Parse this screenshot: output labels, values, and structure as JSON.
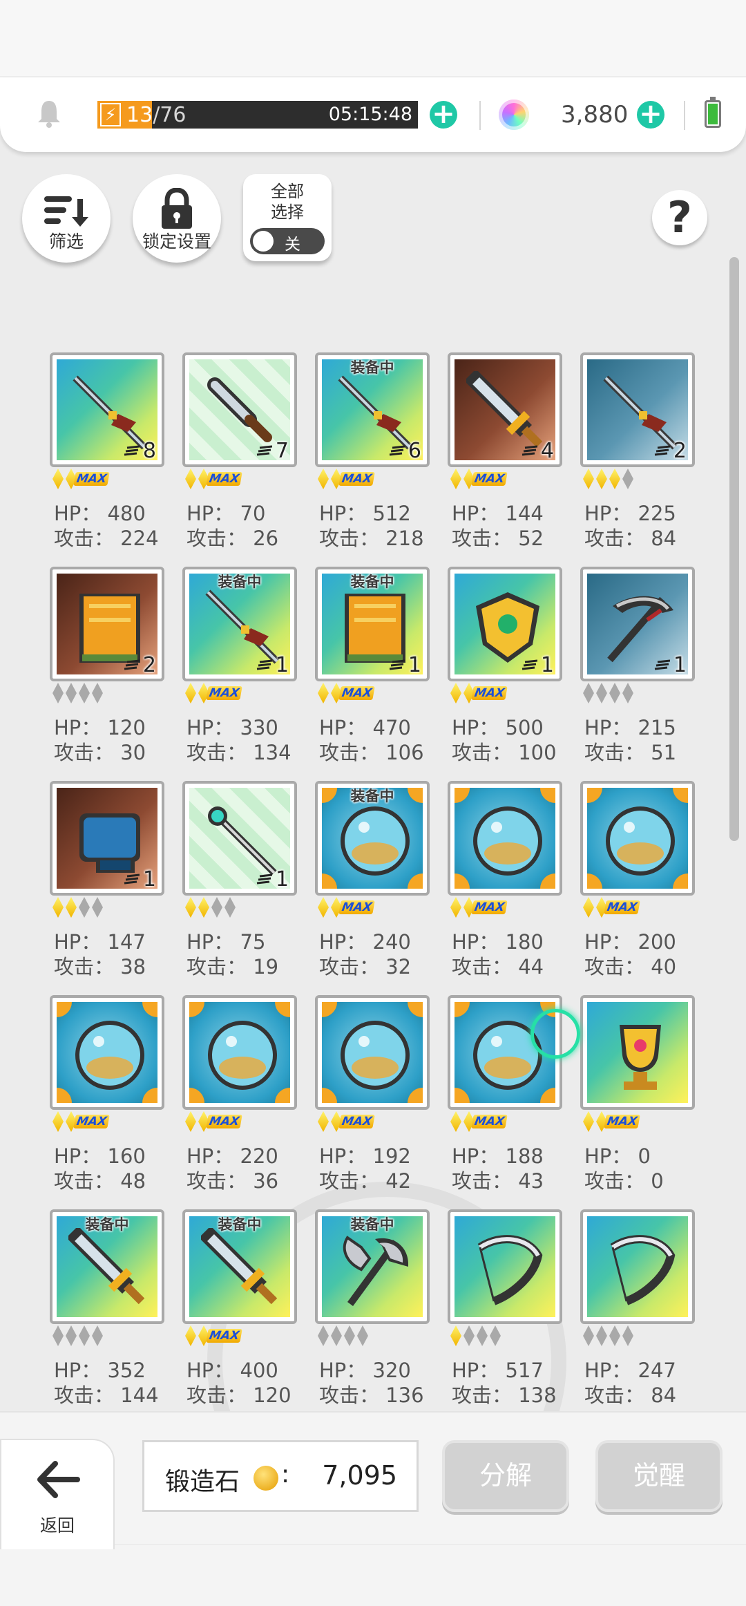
{
  "header": {
    "energy_current": "13",
    "energy_max": "/76",
    "energy_progress": 0.171,
    "timer": "05:15:48",
    "gem_count": "3,880",
    "icons": [
      "bell-icon",
      "lightning-icon",
      "plus-icon",
      "gem-icon",
      "battery-icon"
    ]
  },
  "controls": {
    "filter_label": "筛选",
    "lock_label": "锁定设置",
    "select_all_label": "全部\n选择",
    "toggle_label": "关",
    "help_label": "?"
  },
  "colors": {
    "accent_plus": "#1fc8a6",
    "energy": "#f59a1d",
    "max_badge": "#1b4fd8"
  },
  "items": [
    {
      "equipped": "",
      "count": "8",
      "stars": {
        "gold": 2,
        "grey": 0,
        "max": "MAX"
      },
      "hp": "HP： 480",
      "atk": "攻击： 224",
      "icon": "spear-icon",
      "bg": "rainbow"
    },
    {
      "equipped": "",
      "count": "7",
      "stars": {
        "gold": 2,
        "grey": 0,
        "max": "MAX"
      },
      "hp": "HP： 70",
      "atk": "攻击： 26",
      "icon": "dagger-icon",
      "bg": "mint"
    },
    {
      "equipped": "装备中",
      "count": "6",
      "stars": {
        "gold": 2,
        "grey": 0,
        "max": "MAX"
      },
      "hp": "HP： 512",
      "atk": "攻击： 218",
      "icon": "spear-icon",
      "bg": "rainbow"
    },
    {
      "equipped": "",
      "count": "4",
      "stars": {
        "gold": 2,
        "grey": 0,
        "max": "MAX"
      },
      "hp": "HP： 144",
      "atk": "攻击： 52",
      "icon": "sword-icon",
      "bg": "brown"
    },
    {
      "equipped": "",
      "count": "2",
      "stars": {
        "gold": 3,
        "grey": 1,
        "max": ""
      },
      "hp": "HP： 225",
      "atk": "攻击： 84",
      "icon": "spear-icon",
      "bg": "steel"
    },
    {
      "equipped": "",
      "count": "2",
      "stars": {
        "gold": 0,
        "grey": 4,
        "max": ""
      },
      "hp": "HP： 120",
      "atk": "攻击： 30",
      "icon": "book-icon",
      "bg": "brown"
    },
    {
      "equipped": "装备中",
      "count": "1",
      "stars": {
        "gold": 2,
        "grey": 0,
        "max": "MAX"
      },
      "hp": "HP： 330",
      "atk": "攻击： 134",
      "icon": "spear-icon",
      "bg": "rainbow"
    },
    {
      "equipped": "装备中",
      "count": "1",
      "stars": {
        "gold": 2,
        "grey": 0,
        "max": "MAX"
      },
      "hp": "HP： 470",
      "atk": "攻击： 106",
      "icon": "book-icon",
      "bg": "rainbow"
    },
    {
      "equipped": "",
      "count": "1",
      "stars": {
        "gold": 2,
        "grey": 0,
        "max": "MAX"
      },
      "hp": "HP： 500",
      "atk": "攻击： 100",
      "icon": "shield-icon",
      "bg": "rainbow"
    },
    {
      "equipped": "",
      "count": "1",
      "stars": {
        "gold": 0,
        "grey": 4,
        "max": ""
      },
      "hp": "HP： 215",
      "atk": "攻击： 51",
      "icon": "scythe-icon",
      "bg": "steel"
    },
    {
      "equipped": "",
      "count": "1",
      "stars": {
        "gold": 2,
        "grey": 2,
        "max": ""
      },
      "hp": "HP： 147",
      "atk": "攻击： 38",
      "icon": "gauntlet-icon",
      "bg": "brown"
    },
    {
      "equipped": "",
      "count": "1",
      "stars": {
        "gold": 2,
        "grey": 2,
        "max": ""
      },
      "hp": "HP： 75",
      "atk": "攻击： 19",
      "icon": "staff-icon",
      "bg": "mint"
    },
    {
      "equipped": "装备中",
      "count": "",
      "stars": {
        "gold": 2,
        "grey": 0,
        "max": "MAX"
      },
      "hp": "HP： 240",
      "atk": "攻击： 32",
      "icon": "orb-icon",
      "bg": "sphere"
    },
    {
      "equipped": "",
      "count": "",
      "stars": {
        "gold": 2,
        "grey": 0,
        "max": "MAX"
      },
      "hp": "HP： 180",
      "atk": "攻击： 44",
      "icon": "orb-icon",
      "bg": "sphere"
    },
    {
      "equipped": "",
      "count": "",
      "stars": {
        "gold": 2,
        "grey": 0,
        "max": "MAX"
      },
      "hp": "HP： 200",
      "atk": "攻击： 40",
      "icon": "orb-icon",
      "bg": "sphere"
    },
    {
      "equipped": "",
      "count": "",
      "stars": {
        "gold": 2,
        "grey": 0,
        "max": "MAX"
      },
      "hp": "HP： 160",
      "atk": "攻击： 48",
      "icon": "orb-icon",
      "bg": "sphere"
    },
    {
      "equipped": "",
      "count": "",
      "stars": {
        "gold": 2,
        "grey": 0,
        "max": "MAX"
      },
      "hp": "HP： 220",
      "atk": "攻击： 36",
      "icon": "orb-icon",
      "bg": "sphere"
    },
    {
      "equipped": "",
      "count": "",
      "stars": {
        "gold": 2,
        "grey": 0,
        "max": "MAX"
      },
      "hp": "HP： 192",
      "atk": "攻击： 42",
      "icon": "orb-icon",
      "bg": "sphere"
    },
    {
      "equipped": "",
      "count": "",
      "stars": {
        "gold": 2,
        "grey": 0,
        "max": "MAX"
      },
      "hp": "HP： 188",
      "atk": "攻击： 43",
      "icon": "orb-icon",
      "bg": "sphere"
    },
    {
      "equipped": "",
      "count": "",
      "stars": {
        "gold": 2,
        "grey": 0,
        "max": "MAX"
      },
      "hp": "HP： 0",
      "atk": "攻击： 0",
      "icon": "trophy-icon",
      "bg": "rainbow"
    },
    {
      "equipped": "装备中",
      "count": "",
      "stars": {
        "gold": 0,
        "grey": 4,
        "max": ""
      },
      "hp": "HP： 352",
      "atk": "攻击： 144",
      "icon": "sword-icon",
      "bg": "rainbow"
    },
    {
      "equipped": "装备中",
      "count": "",
      "stars": {
        "gold": 2,
        "grey": 0,
        "max": "MAX"
      },
      "hp": "HP： 400",
      "atk": "攻击： 120",
      "icon": "sword-icon",
      "bg": "rainbow"
    },
    {
      "equipped": "装备中",
      "count": "",
      "stars": {
        "gold": 0,
        "grey": 4,
        "max": ""
      },
      "hp": "HP： 320",
      "atk": "攻击： 136",
      "icon": "axe-icon",
      "bg": "rainbow"
    },
    {
      "equipped": "",
      "count": "",
      "stars": {
        "gold": 1,
        "grey": 3,
        "max": ""
      },
      "hp": "HP： 517",
      "atk": "攻击： 138",
      "icon": "bow-icon",
      "bg": "rainbow"
    },
    {
      "equipped": "",
      "count": "",
      "stars": {
        "gold": 0,
        "grey": 4,
        "max": ""
      },
      "hp": "HP： 247",
      "atk": "攻击： 84",
      "icon": "bow-icon",
      "bg": "rainbow"
    }
  ],
  "footer": {
    "back_label": "返回",
    "forge_label": "锻造石",
    "forge_colon": ":",
    "forge_value": "7,095",
    "decompose_label": "分解",
    "awaken_label": "觉醒"
  }
}
